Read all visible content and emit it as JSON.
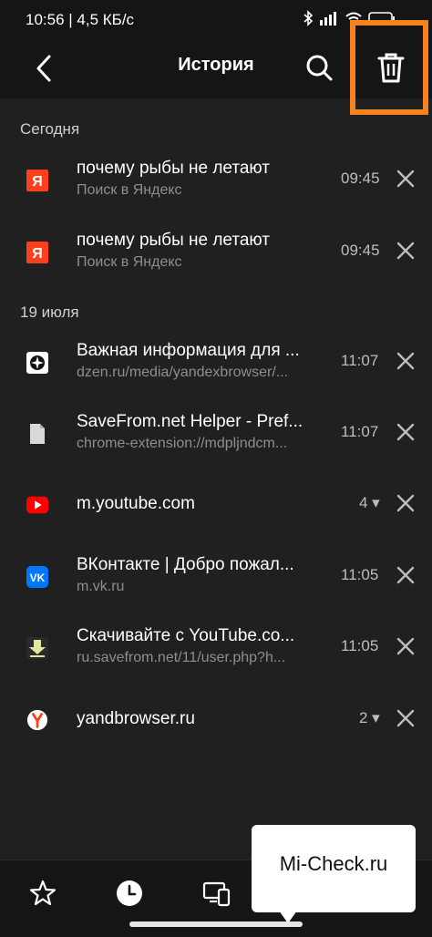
{
  "status": {
    "time_speed": "10:56 | 4,5 КБ/с"
  },
  "toolbar": {
    "title": "История"
  },
  "sections": {
    "today": "Сегодня",
    "july19": "19 июля"
  },
  "rows": [
    {
      "title": "почему рыбы не летают",
      "sub": "Поиск в Яндекс",
      "time": "09:45",
      "icon": "yandex-logo-icon"
    },
    {
      "title": "почему рыбы не летают",
      "sub": "Поиск в Яндекс",
      "time": "09:45",
      "icon": "yandex-logo-icon"
    },
    {
      "title": "Важная информация для ...",
      "sub": "dzen.ru/media/yandexbrowser/...",
      "time": "11:07",
      "icon": "dzen-icon"
    },
    {
      "title": "SaveFrom.net Helper - Pref...",
      "sub": "chrome-extension://mdpljndcm...",
      "time": "11:07",
      "icon": "file-icon"
    },
    {
      "title": "m.youtube.com",
      "count": "4 ▾",
      "icon": "youtube-icon"
    },
    {
      "title": "ВКонтакте | Добро пожал...",
      "sub": "m.vk.ru",
      "time": "11:05",
      "icon": "vk-icon"
    },
    {
      "title": "Скачивайте с YouTube.co...",
      "sub": "ru.savefrom.net/11/user.php?h...",
      "time": "11:05",
      "icon": "savefrom-icon"
    },
    {
      "title": "yandbrowser.ru",
      "count": "2 ▾",
      "icon": "yandex-browser-icon"
    }
  ],
  "watermark": "Mi-Check.ru",
  "colors": {
    "background": "#202020",
    "bar": "#151515",
    "highlight": "#f5821f",
    "yandex_red": "#fc3f1d",
    "youtube_red": "#ff0000",
    "vk_blue": "#0077ff"
  }
}
